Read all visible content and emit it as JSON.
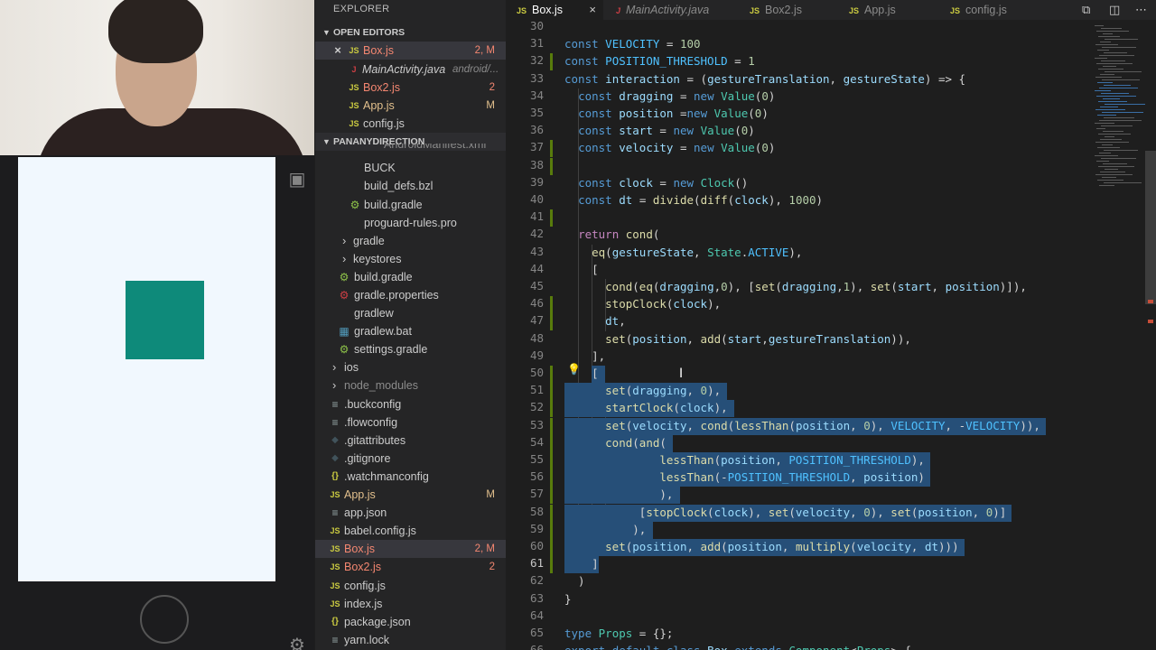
{
  "explorer": {
    "title": "EXPLORER",
    "open_editors_title": "OPEN EDITORS",
    "open_editors": [
      {
        "close": "×",
        "icon": "JS",
        "name": "Box.js",
        "badge": "2, M"
      },
      {
        "icon": "J",
        "name": "MainActivity.java",
        "detail": "android/..."
      },
      {
        "icon": "JS",
        "name": "Box2.js",
        "badge": "2"
      },
      {
        "icon": "JS",
        "name": "App.js",
        "badge": "M"
      },
      {
        "icon": "JS",
        "name": "config.js"
      }
    ],
    "project_title": "PANANYDIRECTION",
    "files": [
      {
        "icon": "▪",
        "name": "AndroidManifest.xml"
      },
      {
        "icon": "▪",
        "name": "BUCK"
      },
      {
        "icon": "▪",
        "name": "build_defs.bzl"
      },
      {
        "icon": "⚙",
        "name": "build.gradle"
      },
      {
        "icon": "▪",
        "name": "proguard-rules.pro"
      },
      {
        "chev": "›",
        "name": "gradle"
      },
      {
        "chev": "›",
        "name": "keystores"
      },
      {
        "icon": "⚙",
        "name": "build.gradle"
      },
      {
        "icon": "⚙",
        "name": "gradle.properties"
      },
      {
        "icon": "▪",
        "name": "gradlew"
      },
      {
        "icon": "▦",
        "name": "gradlew.bat"
      },
      {
        "icon": "⚙",
        "name": "settings.gradle"
      },
      {
        "chev": "›",
        "name": "ios"
      },
      {
        "chev": "›",
        "name": "node_modules"
      },
      {
        "icon": "≡",
        "name": ".buckconfig"
      },
      {
        "icon": "≡",
        "name": ".flowconfig"
      },
      {
        "icon": "◆",
        "name": ".gitattributes"
      },
      {
        "icon": "◆",
        "name": ".gitignore"
      },
      {
        "icon": "{}",
        "name": ".watchmanconfig"
      },
      {
        "icon": "JS",
        "name": "App.js",
        "badge": "M"
      },
      {
        "icon": "≡",
        "name": "app.json"
      },
      {
        "icon": "JS",
        "name": "babel.config.js"
      },
      {
        "icon": "JS",
        "name": "Box.js",
        "badge": "2, M"
      },
      {
        "icon": "JS",
        "name": "Box2.js",
        "badge": "2"
      },
      {
        "icon": "JS",
        "name": "config.js"
      },
      {
        "icon": "JS",
        "name": "index.js"
      },
      {
        "icon": "{}",
        "name": "package.json"
      },
      {
        "icon": "≡",
        "name": "yarn.lock"
      }
    ]
  },
  "tabs": [
    {
      "icon": "JS",
      "name": "Box.js",
      "close": "×"
    },
    {
      "icon": "J",
      "name": "MainActivity.java"
    },
    {
      "icon": "JS",
      "name": "Box2.js"
    },
    {
      "icon": "JS",
      "name": "App.js"
    },
    {
      "icon": "JS",
      "name": "config.js"
    }
  ],
  "editor": {
    "first_line_number": 30,
    "current_line": 61,
    "lines": [
      "",
      "const VELOCITY = 100",
      "const POSITION_THRESHOLD = 1",
      "const interaction = (gestureTranslation, gestureState) => {",
      "  const dragging = new Value(0)",
      "  const position =new Value(0)",
      "  const start = new Value(0)",
      "  const velocity = new Value(0)",
      "",
      "  const clock = new Clock()",
      "  const dt = divide(diff(clock), 1000)",
      "",
      "  return cond(",
      "    eq(gestureState, State.ACTIVE),",
      "    [",
      "      cond(eq(dragging,0), [set(dragging,1), set(start, position)]),",
      "      stopClock(clock),",
      "      dt,",
      "      set(position, add(start,gestureTranslation)),",
      "    ],",
      "    [",
      "      set(dragging, 0),",
      "      startClock(clock),",
      "      set(velocity, cond(lessThan(position, 0), VELOCITY, -VELOCITY)),",
      "      cond(and(",
      "              lessThan(position, POSITION_THRESHOLD),",
      "              lessThan(-POSITION_THRESHOLD, position)",
      "              ),",
      "           [stopClock(clock), set(velocity, 0), set(position, 0)]",
      "          ),",
      "      set(position, add(position, multiply(velocity, dt)))",
      "    ]",
      "  )",
      "}",
      "",
      "type Props = {};",
      "export default class Box extends Component<Props> {"
    ]
  },
  "colors": {
    "selection": "#264f78",
    "teal_box": "#0e8a7a",
    "modified": "#e2c08d",
    "error": "#f48771"
  }
}
